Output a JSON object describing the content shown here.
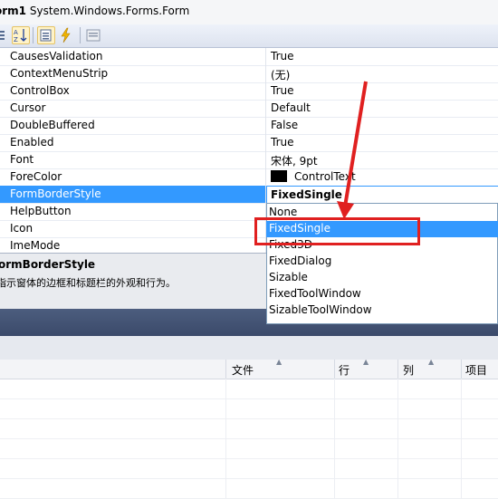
{
  "header": {
    "title_bold": "orm1",
    "title_type": "System.Windows.Forms.Form"
  },
  "properties": [
    {
      "name": "CausesValidation",
      "value": "True"
    },
    {
      "name": "ContextMenuStrip",
      "value": "(无)"
    },
    {
      "name": "ControlBox",
      "value": "True"
    },
    {
      "name": "Cursor",
      "value": "Default"
    },
    {
      "name": "DoubleBuffered",
      "value": "False"
    },
    {
      "name": "Enabled",
      "value": "True"
    },
    {
      "name": "Font",
      "value": "宋体, 9pt"
    },
    {
      "name": "ForeColor",
      "value": "ControlText"
    },
    {
      "name": "FormBorderStyle",
      "value": "FixedSingle"
    },
    {
      "name": "HelpButton",
      "value": ""
    },
    {
      "name": "Icon",
      "value": ""
    },
    {
      "name": "ImeMode",
      "value": ""
    }
  ],
  "dropdown": {
    "current": "FixedSingle",
    "options": [
      "None",
      "FixedSingle",
      "Fixed3D",
      "FixedDialog",
      "Sizable",
      "FixedToolWindow",
      "SizableToolWindow"
    ],
    "highlighted": "FixedSingle"
  },
  "description": {
    "title": "ormBorderStyle",
    "text": "指示窗体的边框和标题栏的外观和行为。"
  },
  "error_list": {
    "columns": [
      "文件",
      "行",
      "列",
      "项目"
    ]
  },
  "colors": {
    "selection": "#3399ff",
    "annotation": "#e02020"
  }
}
